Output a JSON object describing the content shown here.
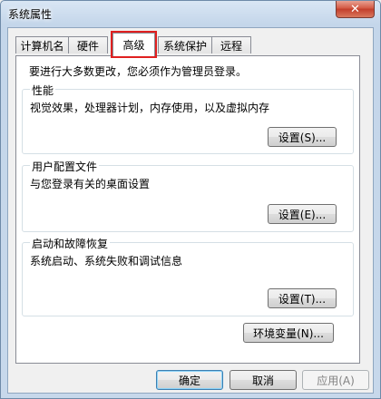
{
  "window": {
    "title": "系统属性",
    "close_glyph": "✕"
  },
  "tabs": [
    {
      "label": "计算机名",
      "active": false
    },
    {
      "label": "硬件",
      "active": false
    },
    {
      "label": "高级",
      "active": true
    },
    {
      "label": "系统保护",
      "active": false
    },
    {
      "label": "远程",
      "active": false
    }
  ],
  "panel": {
    "notice": "要进行大多数更改，您必须作为管理员登录。",
    "performance": {
      "label": "性能",
      "description": "视觉效果，处理器计划，内存使用，以及虚拟内存",
      "button": "设置(S)..."
    },
    "profiles": {
      "label": "用户配置文件",
      "description": "与您登录有关的桌面设置",
      "button": "设置(E)..."
    },
    "startup": {
      "label": "启动和故障恢复",
      "description": "系统启动、系统失败和调试信息",
      "button": "设置(T)..."
    },
    "env_button": "环境变量(N)..."
  },
  "footer": {
    "ok": "确定",
    "cancel": "取消",
    "apply": "应用(A)"
  },
  "colors": {
    "highlight_outline": "#e02020",
    "title_gradient_top": "#d9e6f4",
    "close_button": "#c23e2b"
  }
}
